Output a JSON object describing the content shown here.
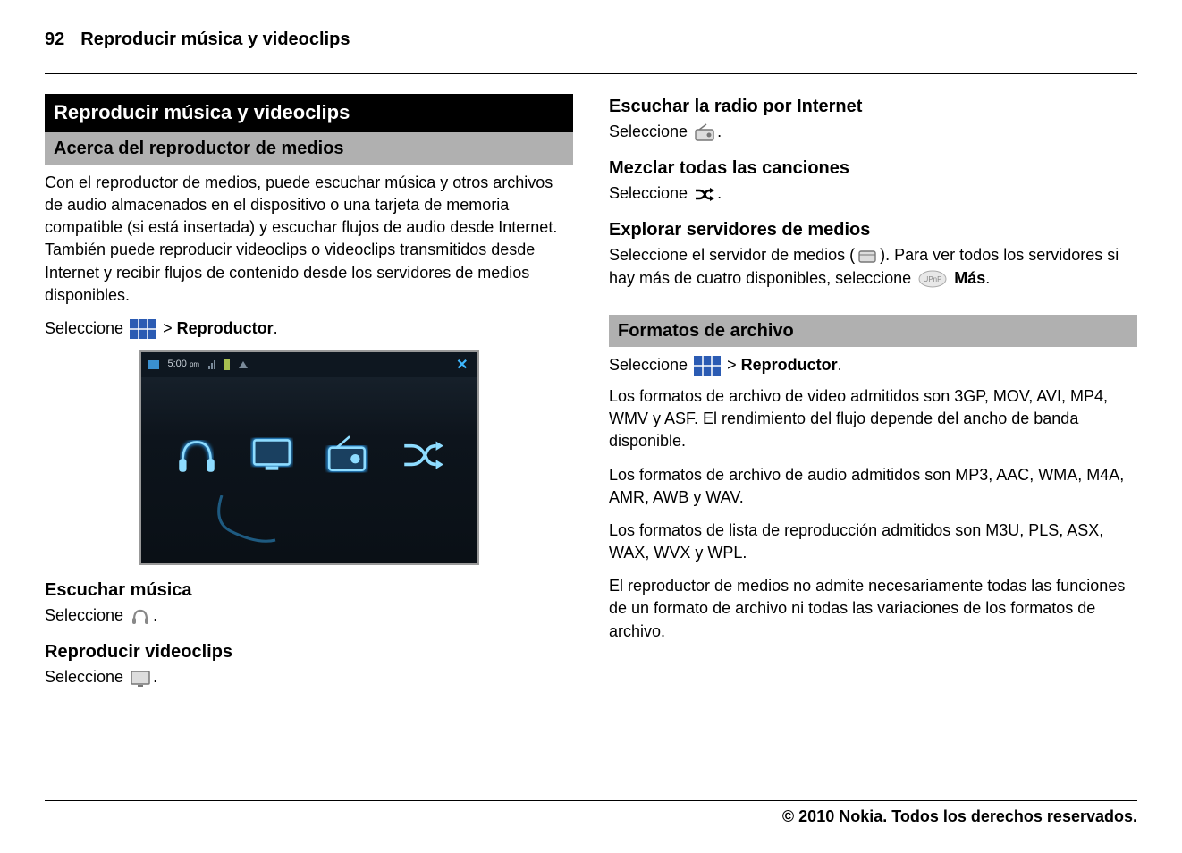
{
  "header": {
    "page_number": "92",
    "title": "Reproducir música y videoclips"
  },
  "left_column": {
    "black_bar": "Reproducir música y videoclips",
    "gray_bar": "Acerca del reproductor de medios",
    "intro": "Con el reproductor de medios, puede escuchar música y otros archivos de audio almacenados en el dispositivo o una tarjeta de memoria compatible (si está insertada) y escuchar flujos de audio desde Internet. También puede reproducir videoclips o videoclips transmitidos desde Internet y recibir flujos de contenido desde los servidores de medios disponibles.",
    "select_prefix": "Seleccione ",
    "select_suffix_gt": " > ",
    "select_suffix_label": "Reproductor",
    "select_period": ".",
    "screenshot_time": "5:00",
    "screenshot_ampm": "pm",
    "h_music": "Escuchar música",
    "t_music": "Seleccione ",
    "h_video": "Reproducir videoclips",
    "t_video": "Seleccione "
  },
  "right_column": {
    "h_radio": "Escuchar la radio por Internet",
    "t_radio": "Seleccione ",
    "h_shuffle": "Mezclar todas las canciones",
    "t_shuffle": "Seleccione ",
    "h_servers": "Explorar servidores de medios",
    "t_servers_1": "Seleccione el servidor de medios (",
    "t_servers_2": "). Para ver todos los servidores si hay más de cuatro disponibles, seleccione ",
    "t_servers_more": "Más",
    "gray_bar": "Formatos de archivo",
    "t_formats_select_prefix": "Seleccione ",
    "t_formats_select_gt": " > ",
    "t_formats_select_label": "Reproductor",
    "p_video": "Los formatos de archivo de video admitidos son 3GP, MOV, AVI, MP4, WMV y ASF. El rendimiento del flujo depende del ancho de banda disponible.",
    "p_audio": "Los formatos de archivo de audio admitidos son MP3, AAC, WMA, M4A, AMR, AWB y WAV.",
    "p_playlist": "Los formatos de lista de reproducción admitidos son M3U, PLS, ASX, WAX, WVX y WPL.",
    "p_disclaimer": "El reproductor de medios no admite necesariamente todas las funciones de un formato de archivo ni todas las variaciones de los formatos de archivo."
  },
  "footer": {
    "copyright": "© 2010 Nokia. Todos los derechos reservados."
  },
  "period": "."
}
